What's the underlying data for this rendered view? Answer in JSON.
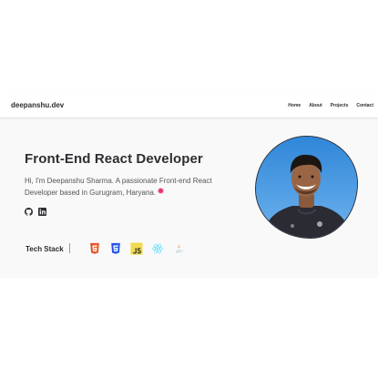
{
  "nav": {
    "brand": "deepanshu.dev",
    "links": [
      {
        "label": "Home"
      },
      {
        "label": "About"
      },
      {
        "label": "Projects"
      },
      {
        "label": "Contact"
      }
    ]
  },
  "hero": {
    "title": "Front-End React Developer",
    "subtitle": "Hi, I'm Deepanshu Sharma. A passionate Front-end React Developer based in Gurugram, Haryana.",
    "pin_icon": "location-pin-icon",
    "socials": [
      {
        "icon": "github-icon"
      },
      {
        "icon": "linkedin-icon"
      }
    ],
    "avatar_icon": "profile-photo"
  },
  "tech_stack": {
    "label": "Tech Stack",
    "icons": [
      "html5-icon",
      "css3-icon",
      "javascript-icon",
      "react-icon",
      "java-icon"
    ]
  },
  "colors": {
    "text": "#2d2e32",
    "hero_bg": "#f9f9f9",
    "html5": "#e44d26",
    "css3": "#264de4",
    "javascript": "#f0db4f",
    "react": "#61dafb",
    "java_blue": "#5382a1",
    "java_orange": "#e76f00"
  }
}
